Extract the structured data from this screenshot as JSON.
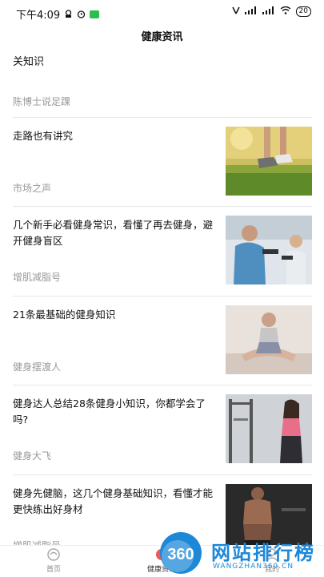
{
  "status_bar": {
    "time": "下午4:09",
    "battery": "20"
  },
  "header": {
    "title": "健康资讯"
  },
  "partial_item": {
    "title": "关知识",
    "source": "陈博士说足踝"
  },
  "articles": [
    {
      "title": "走路也有讲究",
      "source": "市场之声",
      "thumb": "running-shoes-thumb"
    },
    {
      "title": "几个新手必看健身常识，看懂了再去健身，避开健身盲区",
      "source": "增肌减脂号",
      "thumb": "dumbbell-father-son-thumb"
    },
    {
      "title": "21条最基础的健身知识",
      "source": "健身摆渡人",
      "thumb": "woman-stretching-thumb"
    },
    {
      "title": "健身达人总结28条健身小知识，你都学会了吗?",
      "source": "健身大飞",
      "thumb": "woman-gym-thumb"
    },
    {
      "title": "健身先健脑，这几个健身基础知识，看懂才能更快练出好身材",
      "source": "增肌减脂号",
      "thumb": "muscle-man-thumb"
    }
  ],
  "bottom_nav": {
    "items": [
      {
        "label": "首页",
        "icon": "home-icon"
      },
      {
        "label": "健康资讯",
        "icon": "news-icon"
      },
      {
        "label": "我的",
        "icon": "profile-icon"
      }
    ]
  },
  "watermark": {
    "logo": "360",
    "text": "网站排行榜",
    "sub": "WANGZHAN360.CN"
  },
  "colors": {
    "source_text": "#999999",
    "divider": "#e6e6e6",
    "watermark": "#1e88d8"
  }
}
